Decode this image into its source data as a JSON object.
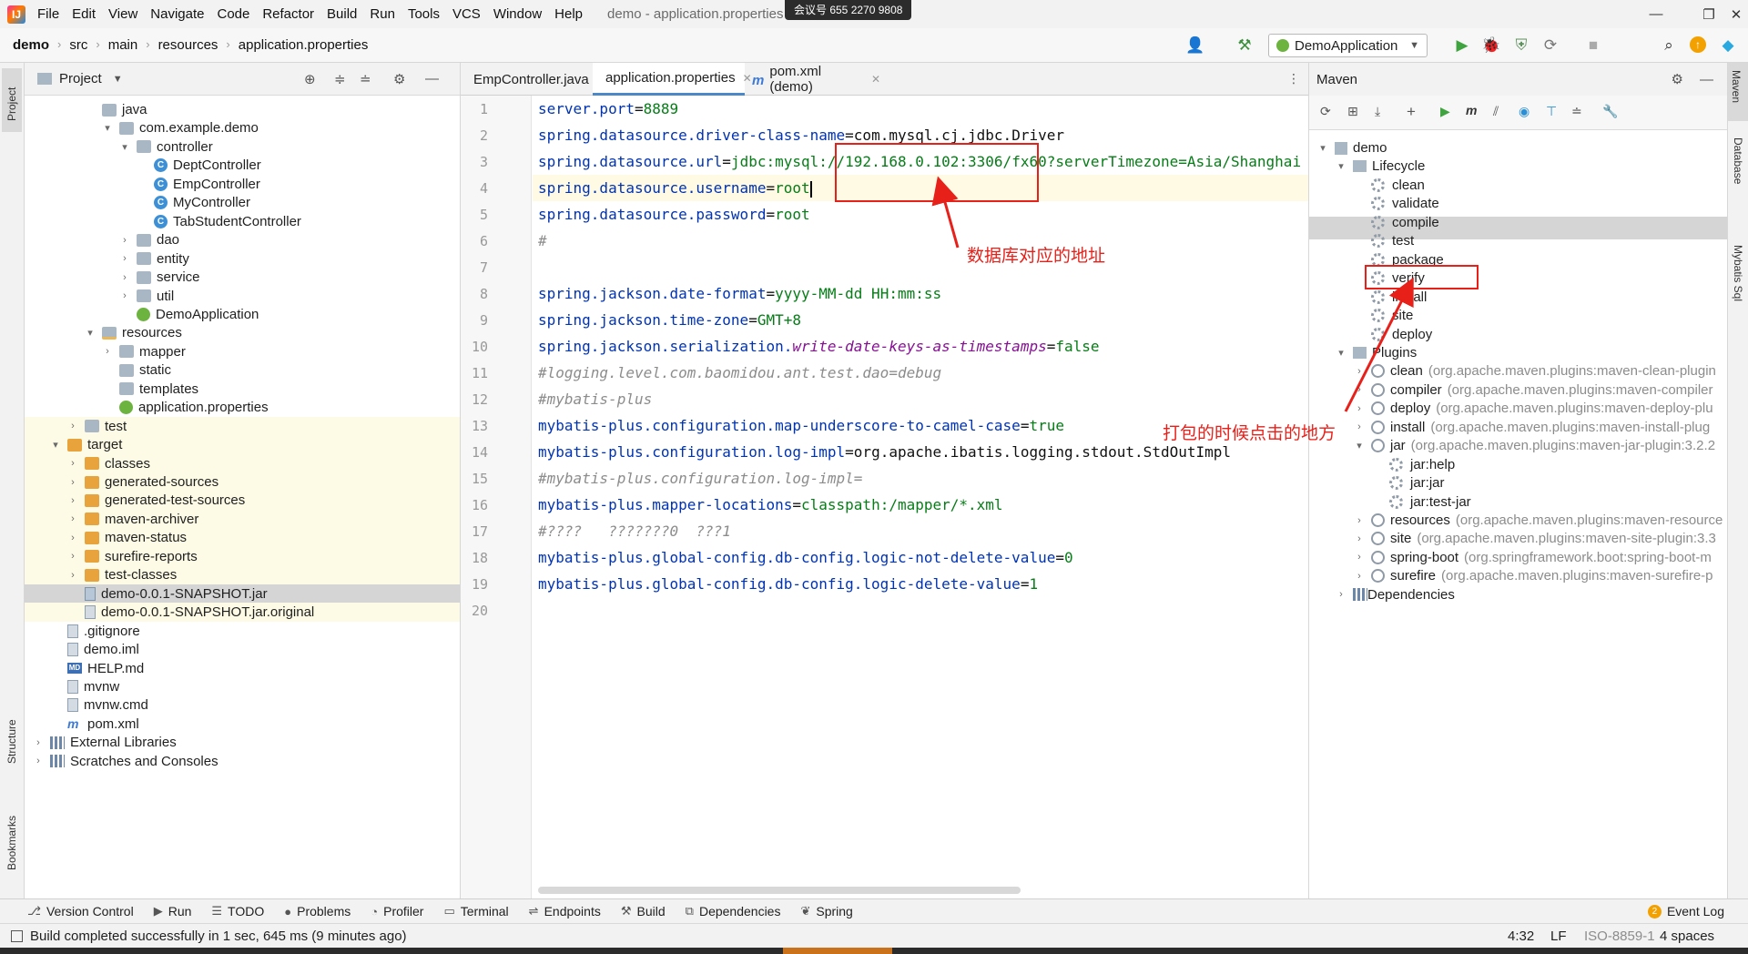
{
  "menu": {
    "items": [
      "File",
      "Edit",
      "View",
      "Navigate",
      "Code",
      "Refactor",
      "Build",
      "Run",
      "Tools",
      "VCS",
      "Window",
      "Help"
    ],
    "window_title": "demo - application.properties - Administrator",
    "meeting_overlay": "会议号 655 2270 9808"
  },
  "breadcrumb": {
    "items": [
      "demo",
      "src",
      "main",
      "resources",
      "application.properties"
    ]
  },
  "run_config": {
    "label": "DemoApplication"
  },
  "project": {
    "title": "Project",
    "tree": [
      {
        "label": "java",
        "indent": 3,
        "icon": "folder",
        "arrow": ""
      },
      {
        "label": "com.example.demo",
        "indent": 4,
        "icon": "pkg",
        "arrow": "▾"
      },
      {
        "label": "controller",
        "indent": 5,
        "icon": "pkg",
        "arrow": "▾"
      },
      {
        "label": "DeptController",
        "indent": 6,
        "icon": "class",
        "arrow": ""
      },
      {
        "label": "EmpController",
        "indent": 6,
        "icon": "class",
        "arrow": ""
      },
      {
        "label": "MyController",
        "indent": 6,
        "icon": "class",
        "arrow": ""
      },
      {
        "label": "TabStudentController",
        "indent": 6,
        "icon": "class",
        "arrow": ""
      },
      {
        "label": "dao",
        "indent": 5,
        "icon": "pkg",
        "arrow": "›"
      },
      {
        "label": "entity",
        "indent": 5,
        "icon": "pkg",
        "arrow": "›"
      },
      {
        "label": "service",
        "indent": 5,
        "icon": "pkg",
        "arrow": "›"
      },
      {
        "label": "util",
        "indent": 5,
        "icon": "pkg",
        "arrow": "›"
      },
      {
        "label": "DemoApplication",
        "indent": 5,
        "icon": "spring",
        "arrow": ""
      },
      {
        "label": "resources",
        "indent": 3,
        "icon": "res",
        "arrow": "▾"
      },
      {
        "label": "mapper",
        "indent": 4,
        "icon": "folder",
        "arrow": "›"
      },
      {
        "label": "static",
        "indent": 4,
        "icon": "folder",
        "arrow": ""
      },
      {
        "label": "templates",
        "indent": 4,
        "icon": "folder",
        "arrow": ""
      },
      {
        "label": "application.properties",
        "indent": 4,
        "icon": "spring",
        "arrow": ""
      },
      {
        "label": "test",
        "indent": 2,
        "icon": "folder",
        "arrow": "›"
      },
      {
        "label": "target",
        "indent": 1,
        "icon": "orange",
        "arrow": "▾"
      },
      {
        "label": "classes",
        "indent": 2,
        "icon": "orange",
        "arrow": "›"
      },
      {
        "label": "generated-sources",
        "indent": 2,
        "icon": "orange",
        "arrow": "›"
      },
      {
        "label": "generated-test-sources",
        "indent": 2,
        "icon": "orange",
        "arrow": "›"
      },
      {
        "label": "maven-archiver",
        "indent": 2,
        "icon": "orange",
        "arrow": "›"
      },
      {
        "label": "maven-status",
        "indent": 2,
        "icon": "orange",
        "arrow": "›"
      },
      {
        "label": "surefire-reports",
        "indent": 2,
        "icon": "orange",
        "arrow": "›"
      },
      {
        "label": "test-classes",
        "indent": 2,
        "icon": "orange",
        "arrow": "›"
      },
      {
        "label": "demo-0.0.1-SNAPSHOT.jar",
        "indent": 2,
        "icon": "jar",
        "arrow": ""
      },
      {
        "label": "demo-0.0.1-SNAPSHOT.jar.original",
        "indent": 2,
        "icon": "file",
        "arrow": ""
      },
      {
        "label": ".gitignore",
        "indent": 1,
        "icon": "file",
        "arrow": ""
      },
      {
        "label": "demo.iml",
        "indent": 1,
        "icon": "file",
        "arrow": ""
      },
      {
        "label": "HELP.md",
        "indent": 1,
        "icon": "md",
        "arrow": ""
      },
      {
        "label": "mvnw",
        "indent": 1,
        "icon": "file",
        "arrow": ""
      },
      {
        "label": "mvnw.cmd",
        "indent": 1,
        "icon": "file",
        "arrow": ""
      },
      {
        "label": "pom.xml",
        "indent": 1,
        "icon": "mvn",
        "arrow": ""
      },
      {
        "label": "External Libraries",
        "indent": 0,
        "icon": "lib",
        "arrow": "›"
      },
      {
        "label": "Scratches and Consoles",
        "indent": 0,
        "icon": "lib",
        "arrow": "›"
      }
    ]
  },
  "editor": {
    "tabs": [
      {
        "label": "EmpController.java",
        "active": false
      },
      {
        "label": "application.properties",
        "active": true
      },
      {
        "label": "pom.xml (demo)",
        "active": false
      }
    ],
    "inspection": "✓1",
    "lines": [
      [
        [
          "k",
          "server.port"
        ],
        [
          "pl",
          "="
        ],
        [
          "v",
          "8889"
        ]
      ],
      [
        [
          "k",
          "spring.datasource.driver-class-name"
        ],
        [
          "pl",
          "="
        ],
        [
          "pl",
          "com.mysql.cj.jdbc.Driver"
        ]
      ],
      [
        [
          "k",
          "spring.datasource.url"
        ],
        [
          "pl",
          "="
        ],
        [
          "v",
          "jdbc:mysql://192.168.0.102:3306/fx60?serverTimezone=Asia/Shanghai"
        ]
      ],
      [
        [
          "k",
          "spring.datasource.username"
        ],
        [
          "pl",
          "="
        ],
        [
          "v",
          "root"
        ]
      ],
      [
        [
          "k",
          "spring.datasource.password"
        ],
        [
          "pl",
          "="
        ],
        [
          "v",
          "root"
        ]
      ],
      [
        [
          "cm",
          "#"
        ]
      ],
      [],
      [
        [
          "k",
          "spring.jackson.date-format"
        ],
        [
          "pl",
          "="
        ],
        [
          "v",
          "yyyy-MM-dd HH:mm:ss"
        ]
      ],
      [
        [
          "k",
          "spring.jackson.time-zone"
        ],
        [
          "pl",
          "="
        ],
        [
          "v",
          "GMT+8"
        ]
      ],
      [
        [
          "k",
          "spring.jackson.serialization."
        ],
        [
          "it",
          "write-date-keys-as-timestamps"
        ],
        [
          "pl",
          "="
        ],
        [
          "v",
          "false"
        ]
      ],
      [
        [
          "cm",
          "#logging.level.com.baomidou.ant.test.dao=debug"
        ]
      ],
      [
        [
          "cm",
          "#mybatis-plus"
        ]
      ],
      [
        [
          "k",
          "mybatis-plus.configuration.map-underscore-to-camel-case"
        ],
        [
          "pl",
          "="
        ],
        [
          "v",
          "true"
        ]
      ],
      [
        [
          "k",
          "mybatis-plus.configuration.log-impl"
        ],
        [
          "pl",
          "="
        ],
        [
          "pl",
          "org.apache.ibatis.logging.stdout.StdOutImpl"
        ]
      ],
      [
        [
          "cm",
          "#mybatis-plus.configuration.log-impl="
        ]
      ],
      [
        [
          "k",
          "mybatis-plus.mapper-locations"
        ],
        [
          "pl",
          "="
        ],
        [
          "v",
          "classpath:/mapper/*.xml"
        ]
      ],
      [
        [
          "cm",
          "#????   ???????0  ???1"
        ]
      ],
      [
        [
          "k",
          "mybatis-plus.global-config.db-config.logic-not-delete-value"
        ],
        [
          "pl",
          "="
        ],
        [
          "v",
          "0"
        ]
      ],
      [
        [
          "k",
          "mybatis-plus.global-config.db-config.logic-delete-value"
        ],
        [
          "pl",
          "="
        ],
        [
          "v",
          "1"
        ]
      ],
      []
    ]
  },
  "maven": {
    "title": "Maven",
    "tree": [
      {
        "label": "demo",
        "dim": "",
        "indent": 0,
        "arrow": "▾",
        "icon": "mvn"
      },
      {
        "label": "Lifecycle",
        "dim": "",
        "indent": 1,
        "arrow": "▾",
        "icon": "folder"
      },
      {
        "label": "clean",
        "dim": "",
        "indent": 2,
        "arrow": "",
        "icon": "gear"
      },
      {
        "label": "validate",
        "dim": "",
        "indent": 2,
        "arrow": "",
        "icon": "gear"
      },
      {
        "label": "compile",
        "dim": "",
        "indent": 2,
        "arrow": "",
        "icon": "gear"
      },
      {
        "label": "test",
        "dim": "",
        "indent": 2,
        "arrow": "",
        "icon": "gear"
      },
      {
        "label": "package",
        "dim": "",
        "indent": 2,
        "arrow": "",
        "icon": "gear",
        "selected": true
      },
      {
        "label": "verify",
        "dim": "",
        "indent": 2,
        "arrow": "",
        "icon": "gear"
      },
      {
        "label": "install",
        "dim": "",
        "indent": 2,
        "arrow": "",
        "icon": "gear"
      },
      {
        "label": "site",
        "dim": "",
        "indent": 2,
        "arrow": "",
        "icon": "gear"
      },
      {
        "label": "deploy",
        "dim": "",
        "indent": 2,
        "arrow": "",
        "icon": "gear"
      },
      {
        "label": "Plugins",
        "dim": "",
        "indent": 1,
        "arrow": "▾",
        "icon": "folder"
      },
      {
        "label": "clean",
        "dim": "(org.apache.maven.plugins:maven-clean-plugin",
        "indent": 2,
        "arrow": "›",
        "icon": "plugin"
      },
      {
        "label": "compiler",
        "dim": "(org.apache.maven.plugins:maven-compiler",
        "indent": 2,
        "arrow": "›",
        "icon": "plugin"
      },
      {
        "label": "deploy",
        "dim": "(org.apache.maven.plugins:maven-deploy-plu",
        "indent": 2,
        "arrow": "›",
        "icon": "plugin"
      },
      {
        "label": "install",
        "dim": "(org.apache.maven.plugins:maven-install-plug",
        "indent": 2,
        "arrow": "›",
        "icon": "plugin"
      },
      {
        "label": "jar",
        "dim": "(org.apache.maven.plugins:maven-jar-plugin:3.2.2",
        "indent": 2,
        "arrow": "▾",
        "icon": "plugin"
      },
      {
        "label": "jar:help",
        "dim": "",
        "indent": 3,
        "arrow": "",
        "icon": "gear"
      },
      {
        "label": "jar:jar",
        "dim": "",
        "indent": 3,
        "arrow": "",
        "icon": "gear"
      },
      {
        "label": "jar:test-jar",
        "dim": "",
        "indent": 3,
        "arrow": "",
        "icon": "gear"
      },
      {
        "label": "resources",
        "dim": "(org.apache.maven.plugins:maven-resource",
        "indent": 2,
        "arrow": "›",
        "icon": "plugin"
      },
      {
        "label": "site",
        "dim": "(org.apache.maven.plugins:maven-site-plugin:3.3",
        "indent": 2,
        "arrow": "›",
        "icon": "plugin"
      },
      {
        "label": "spring-boot",
        "dim": "(org.springframework.boot:spring-boot-m",
        "indent": 2,
        "arrow": "›",
        "icon": "plugin"
      },
      {
        "label": "surefire",
        "dim": "(org.apache.maven.plugins:maven-surefire-p",
        "indent": 2,
        "arrow": "›",
        "icon": "plugin"
      },
      {
        "label": "Dependencies",
        "dim": "",
        "indent": 1,
        "arrow": "›",
        "icon": "lib"
      }
    ]
  },
  "side_labels": {
    "project": "Project",
    "structure": "Structure",
    "bookmarks": "Bookmarks",
    "maven": "Maven",
    "database": "Database",
    "mybatis": "Mybatis Sql"
  },
  "bottom_tools": [
    "Version Control",
    "Run",
    "TODO",
    "Problems",
    "Profiler",
    "Terminal",
    "Endpoints",
    "Build",
    "Dependencies",
    "Spring"
  ],
  "event_log": {
    "label": "Event Log",
    "count": "2"
  },
  "status": {
    "message": "Build completed successfully in 1 sec, 645 ms (9 minutes ago)",
    "position": "4:32",
    "line_sep": "LF",
    "encoding": "ISO-8859-1",
    "indent": "4 spaces"
  },
  "annotations": {
    "db_address": "数据库对应的地址",
    "package_click": "打包的时候点击的地方"
  },
  "colors": {
    "accent": "#4a88c7",
    "annotation_red": "#e8201a",
    "keyword": "#0033b3",
    "value": "#067d17"
  }
}
